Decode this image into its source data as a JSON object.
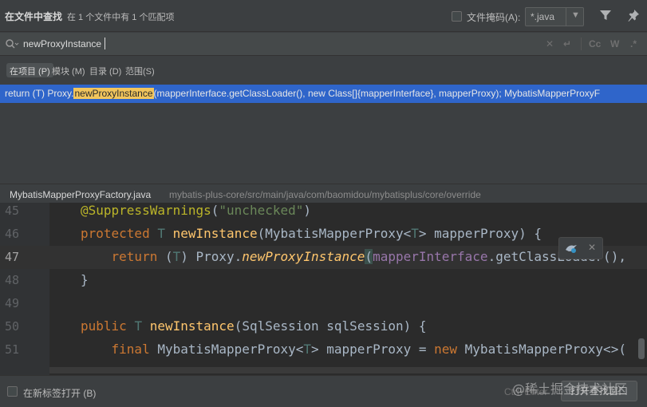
{
  "header": {
    "title": "在文件中查找",
    "subtitle": "在 1 个文件中有 1 个匹配项",
    "file_mask_label": "文件掩码(A):",
    "file_mask_value": "*.java"
  },
  "search": {
    "query": "newProxyInstance"
  },
  "scopes": [
    {
      "label": "在项目 (P)",
      "active": true
    },
    {
      "label": "模块 (M)",
      "active": false
    },
    {
      "label": "目录 (D)",
      "active": false
    },
    {
      "label": "范围(S)",
      "active": false
    }
  ],
  "result": {
    "before": "return (T) Proxy.",
    "match": "newProxyInstance",
    "after": "(mapperInterface.getClassLoader(), new Class[]{mapperInterface}, mapperProxy);  MybatisMapperProxyF"
  },
  "path": {
    "file": "MybatisMapperProxyFactory.java",
    "dir": "mybatis-plus-core/src/main/java/com/baomidou/mybatisplus/core/override"
  },
  "editor": {
    "current_line": 47,
    "line_numbers": [
      "45",
      "46",
      "47",
      "48",
      "49",
      "50",
      "51"
    ]
  },
  "footer": {
    "new_tab_label": "在新标签打开 (B)",
    "shortcut": "Ctrl+Enter",
    "open_button": "打开查找窗口",
    "watermark": "@稀土掘金技术社区"
  },
  "colors": {
    "highlight": "#f2c55c",
    "selection": "#2f65ca",
    "keyword": "#cc7832",
    "annotation": "#bbb529",
    "string": "#6a8759",
    "function": "#ffc66d"
  }
}
